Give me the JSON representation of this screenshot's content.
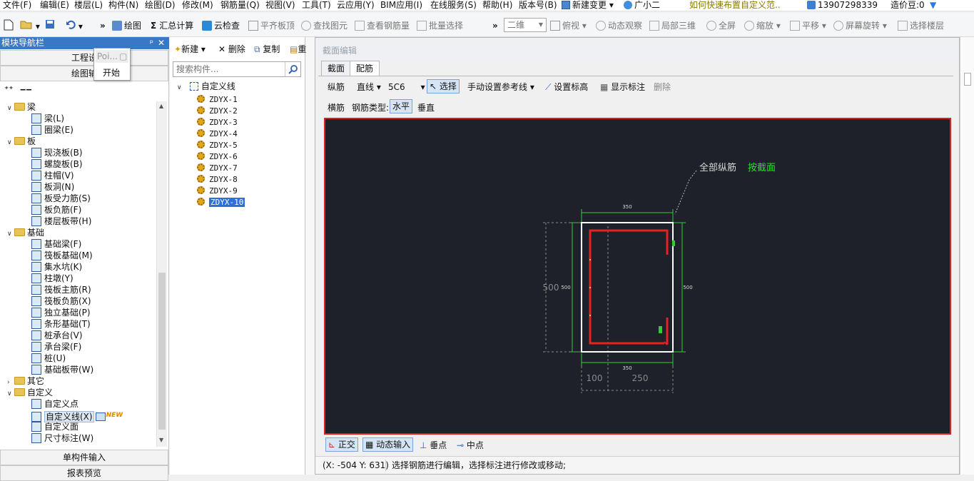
{
  "menu": {
    "items": [
      "文件(F)",
      "编辑(E)",
      "楼层(L)",
      "构件(N)",
      "绘图(D)",
      "修改(M)",
      "钢筋量(Q)",
      "视图(V)",
      "工具(T)",
      "云应用(Y)",
      "BIM应用(I)",
      "在线服务(S)",
      "帮助(H)",
      "版本号(B)"
    ],
    "new_change": "新建变更",
    "assistant": "广小二",
    "tip": "如何快速布置自定义范..",
    "phone": "13907298339",
    "price_beans": "造价豆:0"
  },
  "toolbar": {
    "draw": "绘图",
    "sum_calc": "汇总计算",
    "cloud_check": "云检查",
    "align_slab_top": "平齐板顶",
    "find_element": "查找图元",
    "view_rebar": "查看钢筋量",
    "batch_select": "批量选择",
    "view_mode": "二维",
    "top_view": "俯视",
    "dynamic_view": "动态观察",
    "local_3d": "局部三维",
    "fullscreen": "全屏",
    "zoom": "缩放",
    "pan": "平移",
    "rotate": "屏幕旋转",
    "select_floor": "选择楼层"
  },
  "nav": {
    "title": "模块导航栏",
    "project_settings": "工程设",
    "drawing_input": "绘图输",
    "single_input": "单构件输入",
    "report_preview": "报表预览",
    "popup": {
      "item1": "Poi...",
      "item2": "开始"
    },
    "tree": [
      {
        "type": "folder",
        "label": "梁"
      },
      {
        "type": "item",
        "label": "梁(L)"
      },
      {
        "type": "item",
        "label": "圈梁(E)"
      },
      {
        "type": "folder",
        "label": "板"
      },
      {
        "type": "item",
        "label": "现浇板(B)"
      },
      {
        "type": "item",
        "label": "螺旋板(B)"
      },
      {
        "type": "item",
        "label": "柱帽(V)"
      },
      {
        "type": "item",
        "label": "板洞(N)"
      },
      {
        "type": "item",
        "label": "板受力筋(S)"
      },
      {
        "type": "item",
        "label": "板负筋(F)"
      },
      {
        "type": "item",
        "label": "楼层板带(H)"
      },
      {
        "type": "folder",
        "label": "基础"
      },
      {
        "type": "item",
        "label": "基础梁(F)"
      },
      {
        "type": "item",
        "label": "筏板基础(M)"
      },
      {
        "type": "item",
        "label": "集水坑(K)"
      },
      {
        "type": "item",
        "label": "柱墩(Y)"
      },
      {
        "type": "item",
        "label": "筏板主筋(R)"
      },
      {
        "type": "item",
        "label": "筏板负筋(X)"
      },
      {
        "type": "item",
        "label": "独立基础(P)"
      },
      {
        "type": "item",
        "label": "条形基础(T)"
      },
      {
        "type": "item",
        "label": "桩承台(V)"
      },
      {
        "type": "item",
        "label": "承台梁(F)"
      },
      {
        "type": "item",
        "label": "桩(U)"
      },
      {
        "type": "item",
        "label": "基础板带(W)"
      },
      {
        "type": "folder-closed",
        "label": "其它"
      },
      {
        "type": "folder",
        "label": "自定义"
      },
      {
        "type": "item",
        "label": "自定义点"
      },
      {
        "type": "item-selected",
        "label": "自定义线(X)"
      },
      {
        "type": "item",
        "label": "自定义面"
      },
      {
        "type": "item",
        "label": "尺寸标注(W)"
      }
    ],
    "new_badge": "NEW"
  },
  "components": {
    "new": "新建",
    "delete": "删除",
    "copy": "复制",
    "more": "重",
    "search_placeholder": "搜索构件...",
    "root": "自定义线",
    "items": [
      "ZDYX-1",
      "ZDYX-2",
      "ZDYX-3",
      "ZDYX-4",
      "ZDYX-5",
      "ZDYX-6",
      "ZDYX-7",
      "ZDYX-8",
      "ZDYX-9",
      "ZDYX-10"
    ]
  },
  "editor": {
    "title": "截面编辑",
    "tabs": [
      "截面",
      "配筋"
    ],
    "longitudinal": "纵筋",
    "line_type": "直线",
    "rebar_spec": "5C6",
    "select": "选择",
    "manual_ref": "手动设置参考线",
    "set_elevation": "设置标高",
    "show_annotation": "显示标注",
    "delete": "删除",
    "transverse": "横筋",
    "rebar_type_label": "钢筋类型:",
    "horizontal": "水平",
    "vertical": "垂直",
    "ortho": "正交",
    "dynamic_input": "动态输入",
    "perpendicular": "垂点",
    "midpoint": "中点",
    "coords": "(X: -504 Y: 631)",
    "status_message": "选择钢筋进行编辑，选择标注进行修改或移动;"
  },
  "drawing": {
    "label_all_rebar": "全部纵筋",
    "label_by_section": "按截面",
    "dim_top": "350",
    "dim_bottom": "350",
    "dim_left_big": "500",
    "dim_left_small": "500",
    "dim_right": "500",
    "dim_seg1": "100",
    "dim_seg2": "250"
  }
}
